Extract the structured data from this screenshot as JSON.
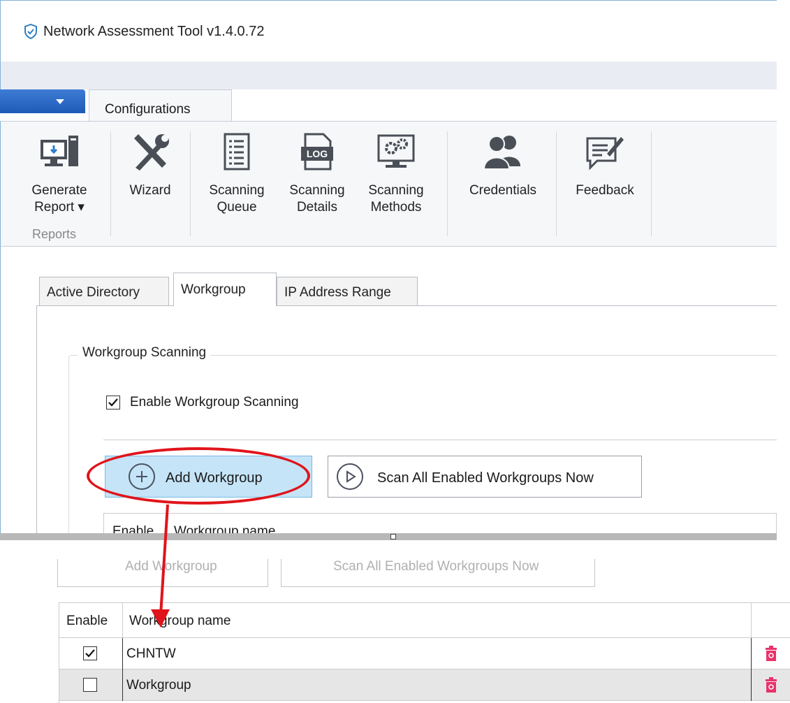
{
  "window": {
    "title": "Network Assessment Tool v1.4.0.72"
  },
  "ribbon": {
    "tab_label": "Configurations",
    "buttons": [
      {
        "label": "Generate",
        "label2": "Report ▾",
        "icon": "generate-report-icon"
      },
      {
        "label": "Wizard",
        "icon": "wizard-tools-icon"
      },
      {
        "label": "Scanning",
        "label2": "Queue",
        "icon": "scanning-queue-icon"
      },
      {
        "label": "Scanning",
        "label2": "Details",
        "icon": "log-file-icon"
      },
      {
        "label": "Scanning",
        "label2": "Methods",
        "icon": "scanning-methods-icon"
      },
      {
        "label": "Credentials",
        "icon": "users-icon"
      },
      {
        "label": "Feedback",
        "icon": "feedback-icon"
      }
    ],
    "group_label": "Reports",
    "log_text": "LOG"
  },
  "subtabs": [
    "Active Directory",
    "Workgroup",
    "IP Address Range"
  ],
  "groupbox": {
    "title": "Workgroup Scanning",
    "enable_label": "Enable Workgroup Scanning",
    "enable_checked": true
  },
  "buttons": {
    "add": "Add Workgroup",
    "scan": "Scan All Enabled Workgroups Now"
  },
  "grid": {
    "headers": [
      "Enable",
      "Workgroup name"
    ],
    "rows": [
      {
        "enabled": true,
        "name": "CHNTW"
      },
      {
        "enabled": false,
        "name": "Workgroup"
      }
    ]
  },
  "colors": {
    "accent_red": "#e0141b",
    "highlight_blue": "#c5e4f7",
    "trash_pink": "#e8336b"
  }
}
